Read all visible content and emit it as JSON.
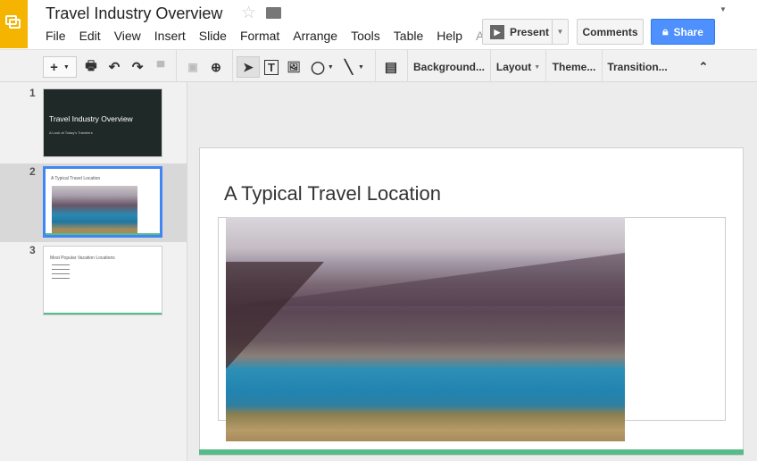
{
  "app": {
    "title": "Travel Industry Overview",
    "logo_icon": "slides-logo-icon"
  },
  "menu": [
    "File",
    "Edit",
    "View",
    "Insert",
    "Slide",
    "Format",
    "Arrange",
    "Tools",
    "Table",
    "Help",
    "A"
  ],
  "buttons": {
    "present": "Present",
    "comments": "Comments",
    "share": "Share"
  },
  "toolbar": {
    "background": "Background...",
    "layout": "Layout",
    "theme": "Theme...",
    "transition": "Transition..."
  },
  "slides": [
    {
      "number": "1",
      "title": "Travel Industry Overview",
      "subtitle": "A Look at Today's Travelers"
    },
    {
      "number": "2",
      "title": "A Typical Travel Location"
    },
    {
      "number": "3",
      "title": "Most Popular Vacation Locations"
    }
  ],
  "current_slide": {
    "title": "A Typical Travel Location"
  },
  "colors": {
    "accent": "#4d90fe",
    "brand": "#f4b400",
    "slide_bar": "#57bb8a"
  }
}
